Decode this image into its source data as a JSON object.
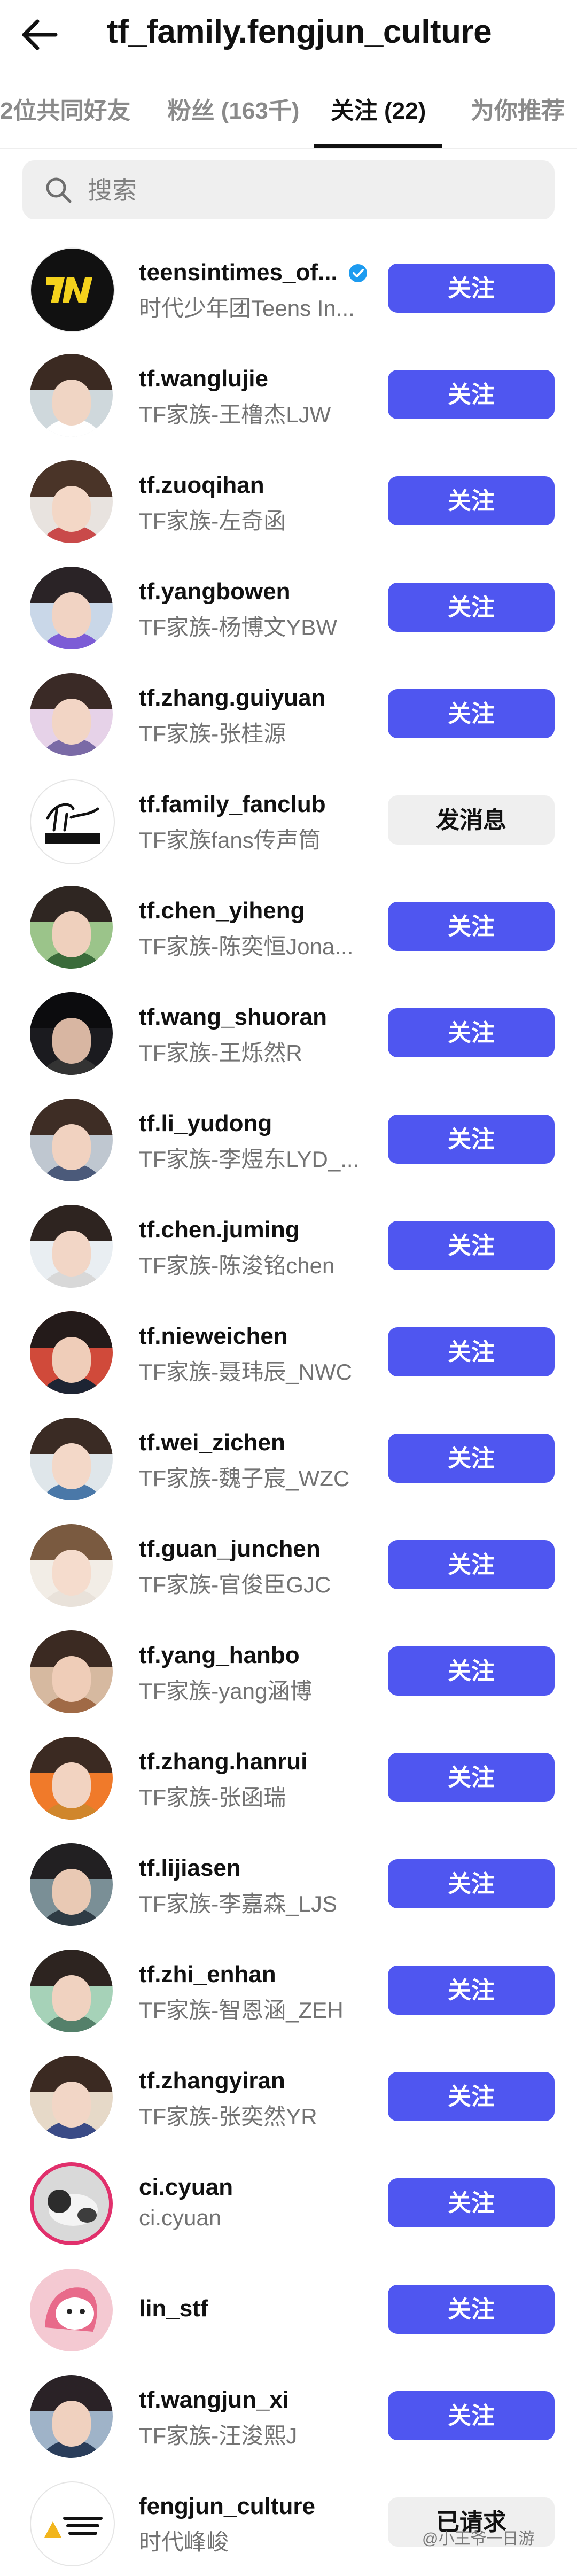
{
  "header": {
    "title": "tf_family.fengjun_culture",
    "back_icon": "arrow-left-icon"
  },
  "tabs": [
    {
      "label": "2位共同好友",
      "active": false
    },
    {
      "label": "粉丝 (163千)",
      "active": false
    },
    {
      "label": "关注 (22)",
      "active": true
    },
    {
      "label": "为你推荐",
      "active": false
    }
  ],
  "search": {
    "placeholder": "搜索",
    "icon": "search-icon"
  },
  "accounts": [
    {
      "username": "teensintimes_of...",
      "subtitle": "时代少年团Teens In...",
      "button": "关注",
      "verified": true
    },
    {
      "username": "tf.wanglujie",
      "subtitle": "TF家族-王橹杰LJW",
      "button": "关注"
    },
    {
      "username": "tf.zuoqihan",
      "subtitle": "TF家族-左奇函",
      "button": "关注"
    },
    {
      "username": "tf.yangbowen",
      "subtitle": "TF家族-杨博文YBW",
      "button": "关注"
    },
    {
      "username": "tf.zhang.guiyuan",
      "subtitle": "TF家族-张桂源",
      "button": "关注"
    },
    {
      "username": "tf.family_fanclub",
      "subtitle": "TF家族fans传声筒",
      "button": "发消息"
    },
    {
      "username": "tf.chen_yiheng",
      "subtitle": "TF家族-陈奕恒Jona...",
      "button": "关注"
    },
    {
      "username": "tf.wang_shuoran",
      "subtitle": "TF家族-王烁然R",
      "button": "关注"
    },
    {
      "username": "tf.li_yudong",
      "subtitle": "TF家族-李煜东LYD_...",
      "button": "关注"
    },
    {
      "username": "tf.chen.juming",
      "subtitle": "TF家族-陈浚铭chen",
      "button": "关注"
    },
    {
      "username": "tf.nieweichen",
      "subtitle": "TF家族-聂玮辰_NWC",
      "button": "关注"
    },
    {
      "username": "tf.wei_zichen",
      "subtitle": "TF家族-魏子宸_WZC",
      "button": "关注"
    },
    {
      "username": "tf.guan_junchen",
      "subtitle": "TF家族-官俊臣GJC",
      "button": "关注"
    },
    {
      "username": "tf.yang_hanbo",
      "subtitle": "TF家族-yang涵博",
      "button": "关注"
    },
    {
      "username": "tf.zhang.hanrui",
      "subtitle": "TF家族-张函瑞",
      "button": "关注"
    },
    {
      "username": "tf.lijiasen",
      "subtitle": "TF家族-李嘉森_LJS",
      "button": "关注"
    },
    {
      "username": "tf.zhi_enhan",
      "subtitle": "TF家族-智恩涵_ZEH",
      "button": "关注"
    },
    {
      "username": "tf.zhangyiran",
      "subtitle": "TF家族-张奕然YR",
      "button": "关注"
    },
    {
      "username": "ci.cyuan",
      "subtitle": "ci.cyuan",
      "button": "关注",
      "story": true
    },
    {
      "username": "lin_stf",
      "subtitle": "",
      "button": "关注"
    },
    {
      "username": "tf.wangjun_xi",
      "subtitle": "TF家族-汪浚熙J",
      "button": "关注"
    },
    {
      "username": "fengjun_culture",
      "subtitle": "时代峰峻",
      "button": "已请求"
    }
  ],
  "watermark": "@小王爷一日游",
  "colors": {
    "follow_button": "#4f56f0",
    "secondary_button": "#efefef",
    "verified_badge": "#1d9bf0"
  }
}
